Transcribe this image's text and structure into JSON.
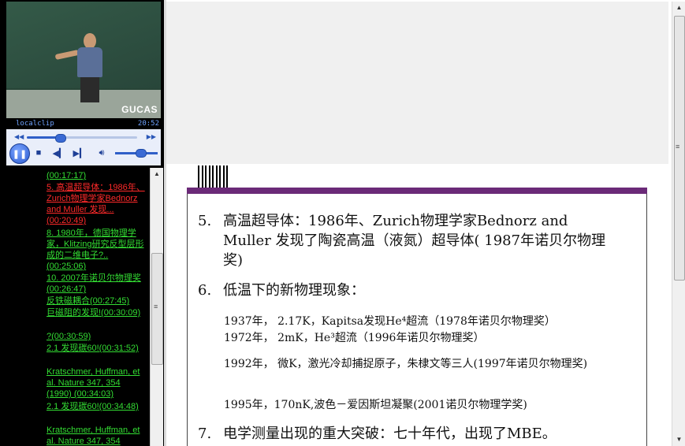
{
  "player": {
    "watermark": "GUCAS",
    "clip_name": "localclip",
    "duration": "20:52",
    "seek_fraction": 0.3,
    "volume_fraction": 0.6,
    "accent": "#2f5fc8"
  },
  "chapters": {
    "items": [
      {
        "text": "(00:17:17)",
        "color": "#33dd33"
      },
      {
        "text": "5. 高温超导体：1986年、Zurich物理学家Bednorz and Muller 发现...(00:20:49)",
        "color": "#ff2a2a"
      },
      {
        "text": "8. 1980年，德国物理学家，Klitzing研究反型层形成的二维电子?..(00:25:06)",
        "color": "#33dd33"
      },
      {
        "text": "10. 2007年诺贝尔物理奖(00:26:47)",
        "color": "#33dd33"
      },
      {
        "text": "反铁磁耦合(00:27:45)",
        "color": "#33dd33"
      },
      {
        "text": "巨磁阻的发现!(00:30:09)",
        "color": "#33dd33"
      },
      {
        "text": "?(00:30:59)",
        "color": "#33dd33"
      },
      {
        "text": "2.1 发现碳60!(00:31:52)",
        "color": "#33dd33"
      },
      {
        "text": "Kratschmer, Huffman, et al. Nature 347, 354 (1990) (00:34:03)",
        "color": "#33dd33"
      },
      {
        "text": "2.1 发现碳60!(00:34:48)",
        "color": "#33dd33"
      },
      {
        "text": "Kratschmer, Huffman, et al. Nature 347, 354",
        "color": "#33dd33"
      }
    ]
  },
  "slide": {
    "band_color": "#6b2a78",
    "item5_num": "5.",
    "item5_text": "高温超导体：1986年、Zurich物理学家Bednorz and Muller 发现了陶瓷高温（液氮）超导体( 1987年诺贝尔物理奖)",
    "item6_num": "6.",
    "item6_text": "低温下的新物理现象：",
    "sub1": "1937年， 2.17K，Kapitsa发现He⁴超流（1978年诺贝尔物理奖）",
    "sub2": "1972年， 2mK，He³超流（1996年诺贝尔物理奖）",
    "sub3": "1992年， 微K，激光冷却捕捉原子，朱棣文等三人(1997年诺贝尔物理奖)",
    "sub4": "1995年，170nK,波色－爱因斯坦凝聚(2001诺贝尔物理学奖)",
    "item7_num": "7.",
    "item7_text": "电学测量出现的重大突破：七十年代，出现了MBE。"
  },
  "icons": {
    "play": "pause-icon",
    "stop": "stop-icon",
    "prev": "previous-icon",
    "next": "next-icon",
    "volume": "speaker-icon"
  }
}
